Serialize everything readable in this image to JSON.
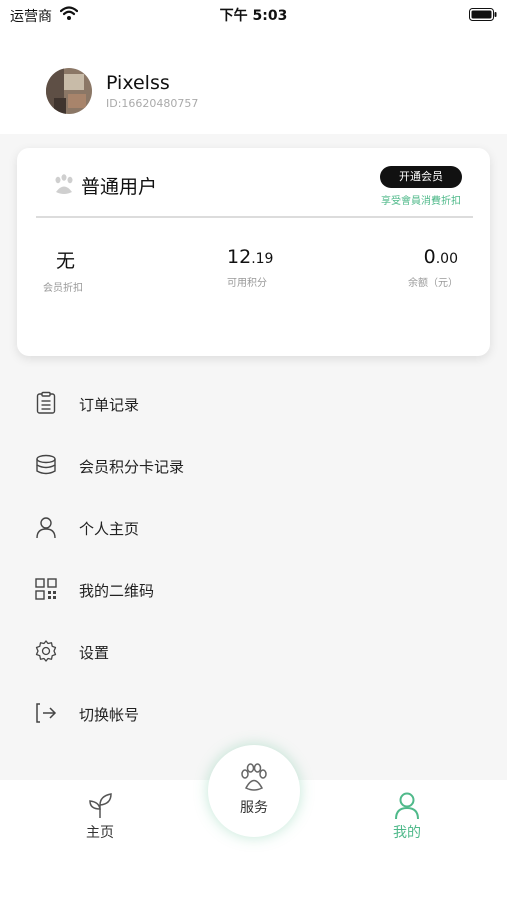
{
  "status_bar": {
    "carrier": "运营商",
    "time": "下午 5:03"
  },
  "profile": {
    "name": "Pixelss",
    "id": "ID:16620480757"
  },
  "member_card": {
    "level": "普通用户",
    "open_vip_label": "开通会员",
    "vip_hint": "享受會員消費折扣",
    "stats": {
      "discount": {
        "value": "无",
        "label": "会员折扣"
      },
      "points": {
        "value_main": "12",
        "value_decimal": ".19",
        "label": "可用积分"
      },
      "balance": {
        "value_main": "0",
        "value_decimal": ".00",
        "label": "余额（元）"
      }
    }
  },
  "menu": [
    {
      "label": "订单记录",
      "icon": "clipboard-icon"
    },
    {
      "label": "会员积分卡记录",
      "icon": "coins-stack-icon"
    },
    {
      "label": "个人主页",
      "icon": "user-icon"
    },
    {
      "label": "我的二维码",
      "icon": "qrcode-icon"
    },
    {
      "label": "设置",
      "icon": "gear-icon"
    },
    {
      "label": "切换帐号",
      "icon": "logout-icon"
    }
  ],
  "tabbar": {
    "home": {
      "label": "主页",
      "icon": "sprout-icon"
    },
    "service": {
      "label": "服务",
      "icon": "paw-icon"
    },
    "mine": {
      "label": "我的",
      "icon": "user-icon",
      "active": true
    }
  },
  "colors": {
    "accent": "#4fb98a",
    "button_dark": "#111111",
    "background": "#f6f6f6"
  }
}
